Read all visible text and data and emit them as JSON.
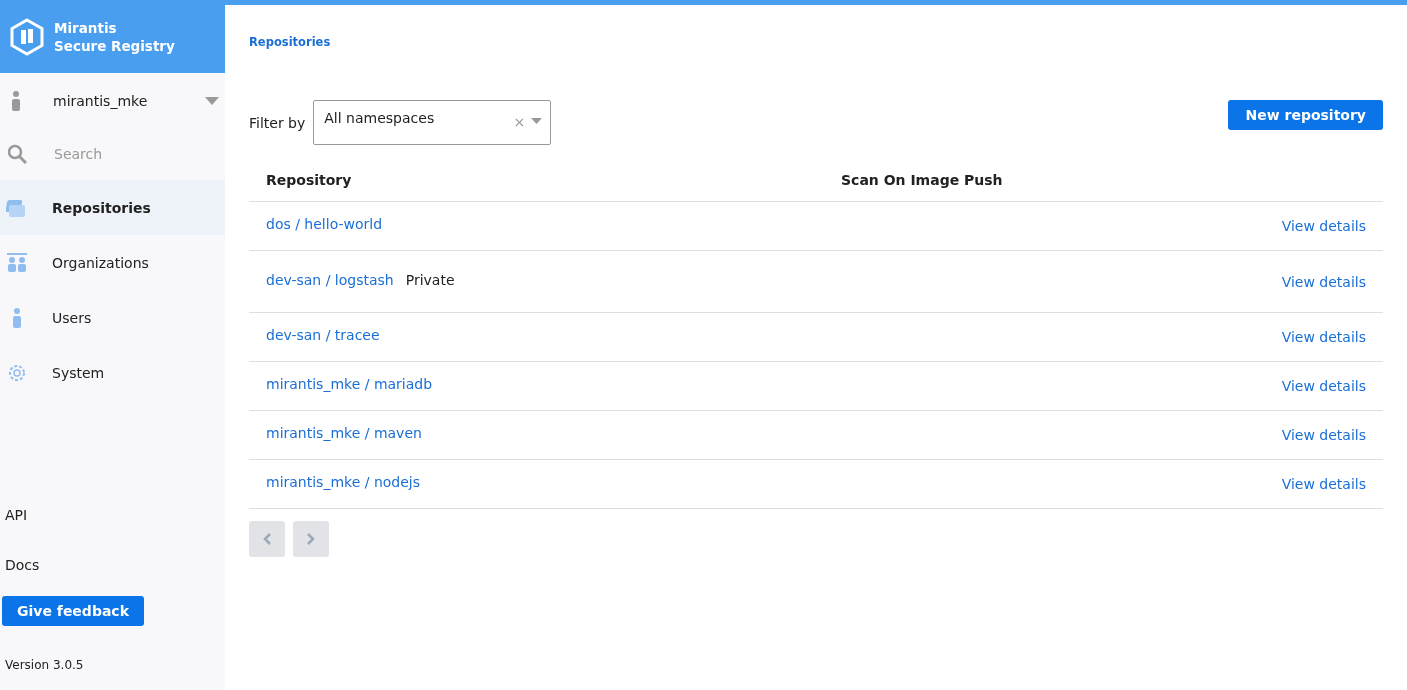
{
  "brand": {
    "line1": "Mirantis",
    "line2": "Secure Registry"
  },
  "user": {
    "name": "mirantis_mke"
  },
  "search": {
    "placeholder": "Search"
  },
  "nav": [
    {
      "label": "Repositories",
      "selected": true
    },
    {
      "label": "Organizations",
      "selected": false
    },
    {
      "label": "Users",
      "selected": false
    },
    {
      "label": "System",
      "selected": false
    }
  ],
  "links": [
    "API",
    "Docs"
  ],
  "feedback_button": "Give feedback",
  "version": "Version 3.0.5",
  "breadcrumb": "Repositories",
  "filter": {
    "label": "Filter by",
    "value": "All namespaces",
    "clear": "×"
  },
  "new_button": "New repository",
  "table": {
    "columns": [
      "Repository",
      "Scan On Image Push"
    ],
    "rows": [
      {
        "name": "dos / hello-world",
        "tag": null,
        "action": "View details"
      },
      {
        "name": "dev-san / logstash",
        "tag": "Private",
        "action": "View details"
      },
      {
        "name": "dev-san / tracee",
        "tag": null,
        "action": "View details"
      },
      {
        "name": "mirantis_mke / mariadb",
        "tag": null,
        "action": "View details"
      },
      {
        "name": "mirantis_mke / maven",
        "tag": null,
        "action": "View details"
      },
      {
        "name": "mirantis_mke / nodejs",
        "tag": null,
        "action": "View details"
      }
    ]
  },
  "pager": {
    "prev_disabled": true,
    "next_disabled": true
  }
}
